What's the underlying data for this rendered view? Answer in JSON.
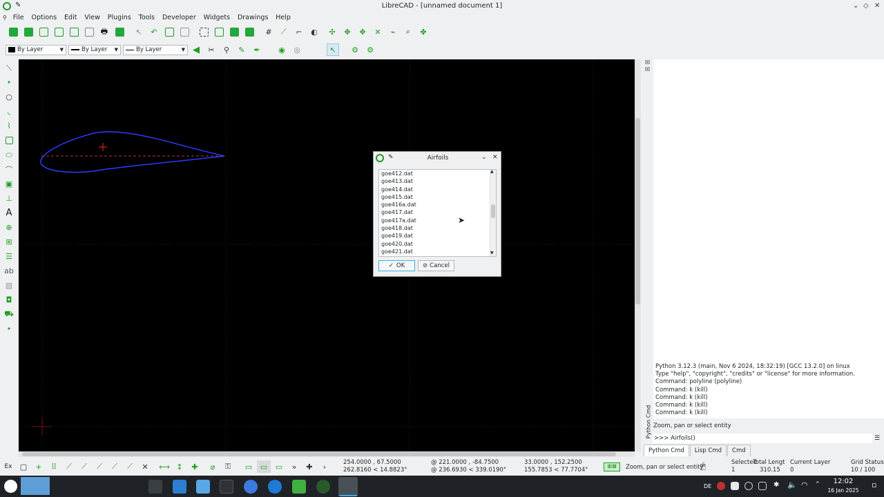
{
  "window": {
    "title": "LibreCAD - [unnamed document 1]"
  },
  "menu": [
    "File",
    "Options",
    "Edit",
    "View",
    "Plugins",
    "Tools",
    "Developer",
    "Widgets",
    "Drawings",
    "Help"
  ],
  "pen": {
    "color_label": "By Layer",
    "width_label": "By Layer",
    "type_label": "By Layer"
  },
  "dialog": {
    "title": "Airfoils",
    "items": [
      "goe412.dat",
      "goe413.dat",
      "goe414.dat",
      "goe415.dat",
      "goe416a.dat",
      "goe417.dat",
      "goe417a.dat",
      "goe418.dat",
      "goe419.dat",
      "goe420.dat",
      "goe421.dat"
    ],
    "ok_label": "OK",
    "cancel_label": "Cancel"
  },
  "python_console": {
    "lines": [
      "Python 3.12.3 (main, Nov  6 2024, 18:32:19) [GCC 13.2.0] on linux",
      "Type \"help\", \"copyright\", \"credits\" or \"license\" for more information.",
      "Command: polyline (polyline)",
      "Command: k (kill)",
      "Command: k (kill)",
      "Command: k (kill)",
      "Command: k (kill)"
    ],
    "status": "Zoom, pan or select entity",
    "input": ">>> Airfoils()",
    "dock_title": "Python Cmd",
    "tabs": [
      "Python Cmd",
      "Lisp Cmd",
      "Cmd"
    ]
  },
  "status": {
    "ex_label": "Ex",
    "coord_abs": "254.0000 , 67.5000",
    "coord_polar": "262.8160 < 14.8823°",
    "coord_rel": "@  221.0000 , -84.7500",
    "coord_rel_polar": "@  236.6930 < 339.0190°",
    "coord_abs2": "33.0000 , 152.2500",
    "coord_polar2": "155.7853 < 77.7704°",
    "action": "Zoom, pan or select entity",
    "selected_label": "Selected",
    "selected_value": "1",
    "total_label": "Total Lengt",
    "total_value": "310.15",
    "layer_label": "Current Layer",
    "layer_value": "0",
    "grid_label": "Grid Status",
    "grid_value": "10 / 100"
  },
  "taskbar": {
    "lang": "DE",
    "time": "12:02",
    "date": "16 Jan 2025"
  },
  "colors": {
    "accent": "#22a83a",
    "canvas": "#000000",
    "airfoil": "#2a3cff",
    "taskbar": "#1f2328"
  }
}
